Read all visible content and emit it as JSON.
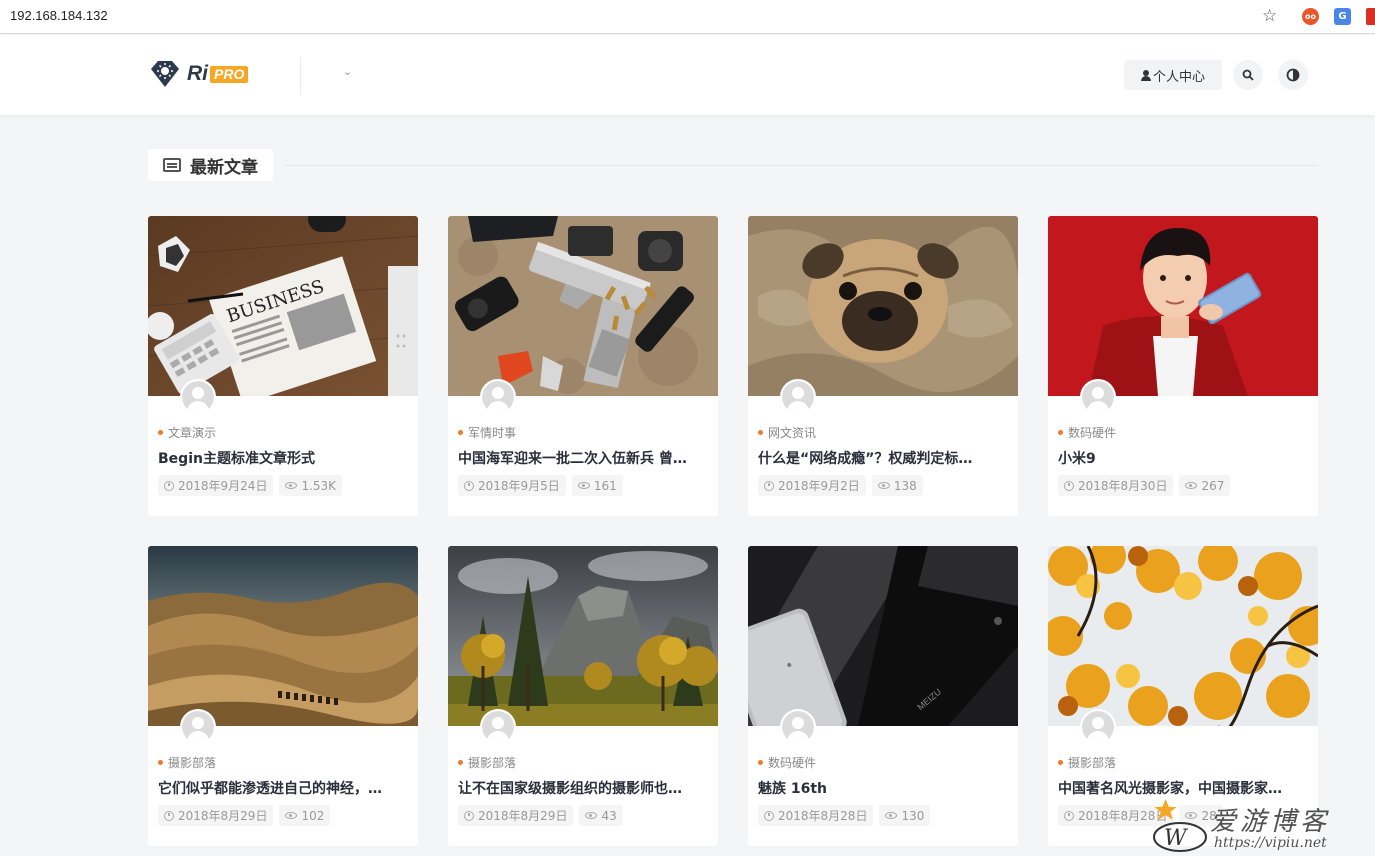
{
  "browser": {
    "url": "192.168.184.132"
  },
  "header": {
    "logo_ri": "Ri",
    "logo_pro": "PRO",
    "user_center": "个人中心"
  },
  "section": {
    "title": "最新文章"
  },
  "posts": [
    {
      "category": "文章演示",
      "title": "Begin主题标准文章形式",
      "date": "2018年9月24日",
      "views": "1.53K"
    },
    {
      "category": "军情时事",
      "title": "中国海军迎来一批二次入伍新兵 曾…",
      "date": "2018年9月5日",
      "views": "161"
    },
    {
      "category": "网文资讯",
      "title": "什么是“网络成瘾”？权威判定标…",
      "date": "2018年9月2日",
      "views": "138"
    },
    {
      "category": "数码硬件",
      "title": "小米9",
      "date": "2018年8月30日",
      "views": "267"
    },
    {
      "category": "摄影部落",
      "title": "它们似乎都能渗透进自己的神经，…",
      "date": "2018年8月29日",
      "views": "102"
    },
    {
      "category": "摄影部落",
      "title": "让不在国家级摄影组织的摄影师也…",
      "date": "2018年8月29日",
      "views": "43"
    },
    {
      "category": "数码硬件",
      "title": "魅族 16th",
      "date": "2018年8月28日",
      "views": "130"
    },
    {
      "category": "摄影部落",
      "title": "中国著名风光摄影家，中国摄影家…",
      "date": "2018年8月28日",
      "views": "28"
    }
  ],
  "watermark": {
    "text": "爱游博客",
    "url": "https://vipiu.net"
  },
  "colors": {
    "accent_orange": "#f27b2a",
    "logo_orange": "#f5a623",
    "logo_navy": "#2d3a4b",
    "page_bg": "#f4f5f7"
  },
  "icons": [
    "star-icon",
    "extension-icon",
    "translate-icon",
    "user-icon",
    "search-icon",
    "theme-toggle-icon",
    "article-list-icon",
    "clock-icon",
    "eye-icon",
    "avatar-icon",
    "chevron-down-icon"
  ]
}
